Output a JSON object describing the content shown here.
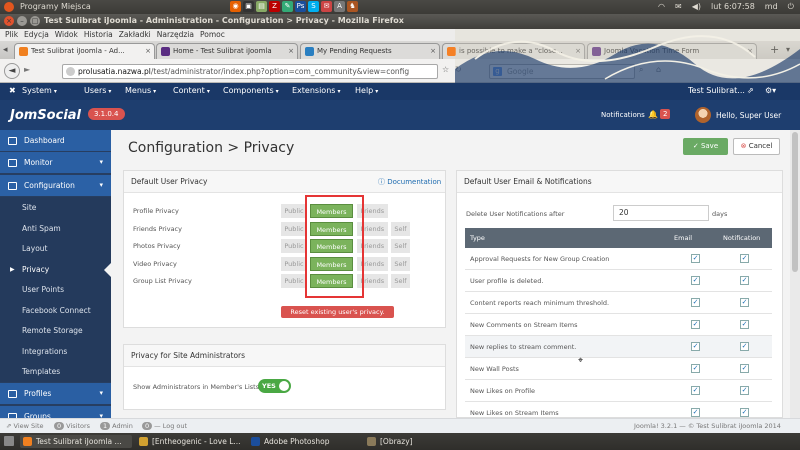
{
  "os": {
    "places": "Programy Miejsca",
    "tray_icons": [
      "firefox-icon",
      "terminal-icon",
      "files-icon",
      "filezilla-icon",
      "text-editor-icon",
      "photoshop-icon",
      "skype-icon",
      "mail-icon",
      "font-icon",
      "game-icon"
    ],
    "clock": "lut 6:07:58",
    "user": "md"
  },
  "window": {
    "title": "Test Sulibrat iJoomla - Administration - Configuration > Privacy - Mozilla Firefox"
  },
  "menubar": [
    "Plik",
    "Edycja",
    "Widok",
    "Historia",
    "Zakładki",
    "Narzędzia",
    "Pomoc"
  ],
  "tabs": [
    {
      "label": "Test Sulibrat iJoomla - Ad...",
      "color": "#f08020"
    },
    {
      "label": "Home - Test Sulibrat iJoomla",
      "color": "#5a2d82"
    },
    {
      "label": "My Pending Requests",
      "color": "#2a7fc1"
    },
    {
      "label": "is possible to make a \"close...",
      "color": "#f58025"
    },
    {
      "label": "Joomla Vacation Time Form",
      "color": "#5a2d82"
    }
  ],
  "address": {
    "host": "prolusatia.nazwa.pl",
    "path": "/test/administrator/index.php?option=com_community&view=config"
  },
  "search": {
    "placeholder": "Google"
  },
  "joomla_menu": [
    "System",
    "Users",
    "Menus",
    "Content",
    "Components",
    "Extensions",
    "Help"
  ],
  "joomla_site": "Test Sulibrat...",
  "header": {
    "logo": "JomSocial",
    "version": "3.1.0.4",
    "notifications": "Notifications",
    "notif_count": "2",
    "hello": "Hello, Super User"
  },
  "sidebar": {
    "dashboard": "Dashboard",
    "monitor": "Monitor",
    "configuration": "Configuration",
    "sub": [
      "Site",
      "Anti Spam",
      "Layout",
      "Privacy",
      "User Points",
      "Facebook Connect",
      "Remote Storage",
      "Integrations",
      "Templates"
    ],
    "profiles": "Profiles",
    "groups": "Groups"
  },
  "page": {
    "title": "Configuration > Privacy",
    "save": "Save",
    "cancel": "Cancel"
  },
  "privacy": {
    "heading": "Default User Privacy",
    "doc": "Documentation",
    "options": [
      "Public",
      "Members",
      "Friends",
      "Self"
    ],
    "rows": [
      {
        "label": "Profile Privacy",
        "has_self": false
      },
      {
        "label": "Friends Privacy",
        "has_self": true
      },
      {
        "label": "Photos Privacy",
        "has_self": true
      },
      {
        "label": "Video Privacy",
        "has_self": true
      },
      {
        "label": "Group List Privacy",
        "has_self": true
      }
    ],
    "selected": "Members",
    "reset": "Reset existing user's privacy."
  },
  "admins": {
    "heading": "Privacy for Site Administrators",
    "label": "Show Administrators in Member's Lists",
    "toggle": "YES"
  },
  "email": {
    "heading": "Default User Email & Notifications",
    "delete_label": "Delete User Notifications after",
    "delete_value": "20",
    "days": "days",
    "cols": [
      "Type",
      "Email",
      "Notification"
    ],
    "rows": [
      "Approval Requests for New Group Creation",
      "User profile is deleted.",
      "Content reports reach minimum threshold.",
      "New Comments on Stream Items",
      "New replies to stream comment.",
      "New Wall Posts",
      "New Likes on Profile",
      "New Likes on Stream Items"
    ]
  },
  "footer": {
    "view_site": "View Site",
    "visitors_count": "0",
    "visitors": "Visitors",
    "admin_count": "1",
    "admin": "Admin",
    "logout_count": "0",
    "logout": "Log out",
    "copyright": "Joomla! 3.2.1 — © Test Sulibrat iJoomla 2014"
  },
  "taskbar": [
    {
      "label": "Test Sulibrat iJoomla ...",
      "color": "#f08020"
    },
    {
      "label": "[Entheogenic - Love L...",
      "color": "#d0a030"
    },
    {
      "label": "Adobe Photoshop",
      "color": "#1b4e9c"
    },
    {
      "label": "[Obrazy]",
      "color": "#8a7a5a"
    }
  ]
}
